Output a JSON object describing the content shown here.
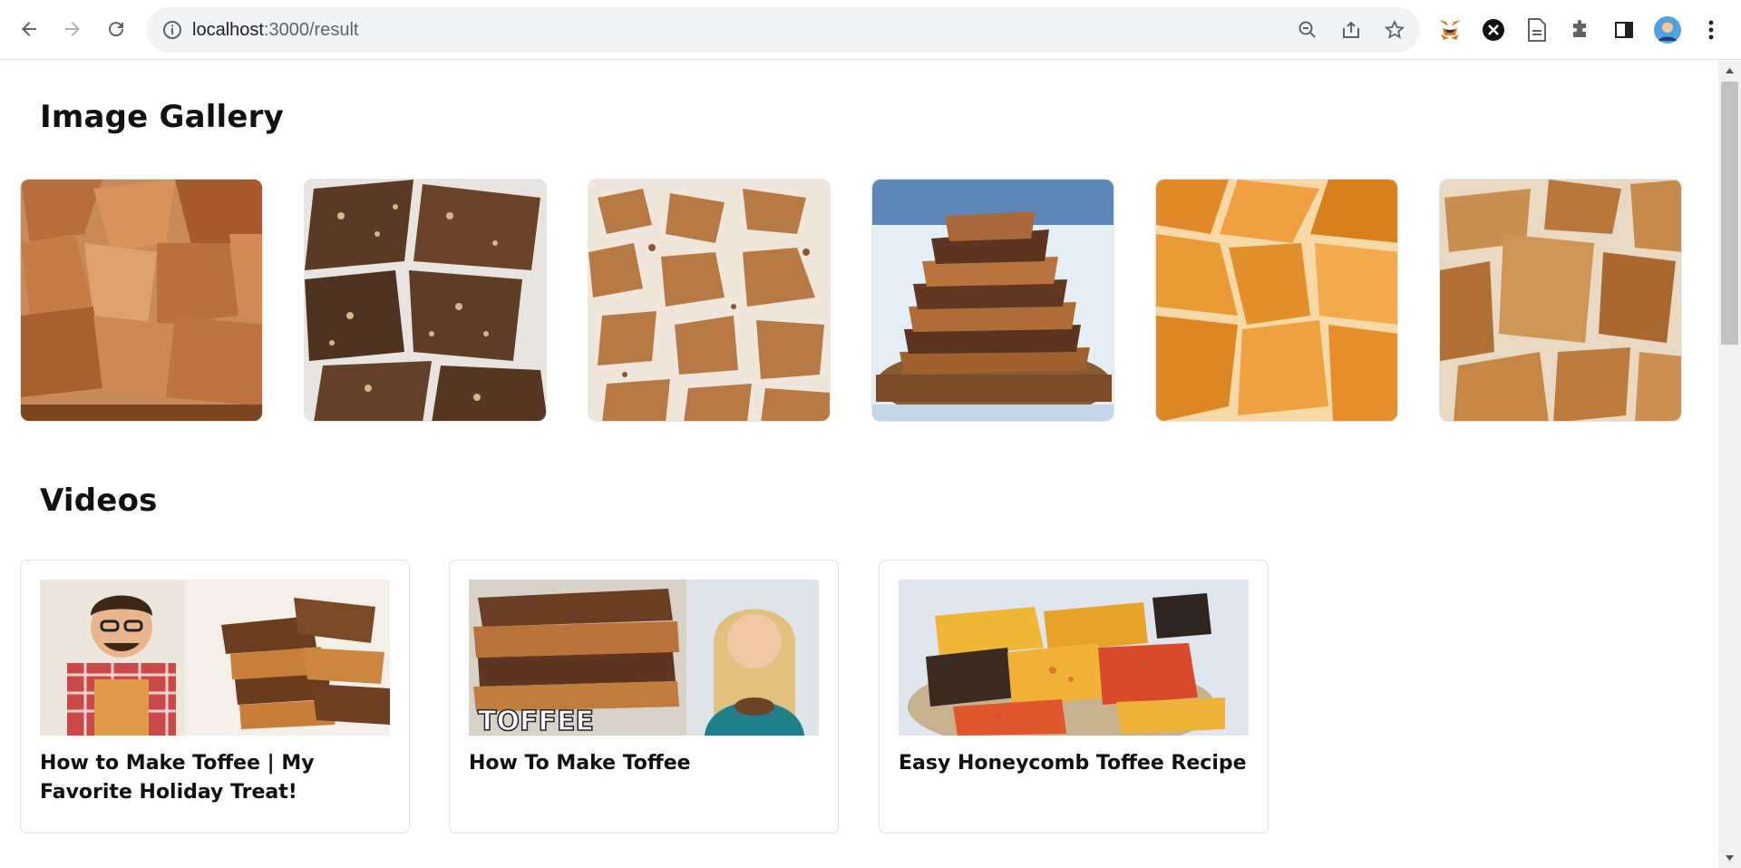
{
  "browser": {
    "url_host": "localhost",
    "url_path": ":3000/result"
  },
  "gallery": {
    "heading": "Image Gallery",
    "images": [
      {
        "icon": "toffee-chunks-photo"
      },
      {
        "icon": "nut-toffee-bark-photo"
      },
      {
        "icon": "crushed-toffee-photo"
      },
      {
        "icon": "stacked-toffee-photo"
      },
      {
        "icon": "amber-toffee-shards-photo"
      },
      {
        "icon": "toffee-pieces-photo"
      }
    ]
  },
  "videos": {
    "heading": "Videos",
    "items": [
      {
        "title": "How to Make Toffee | My Favorite Holiday Treat!"
      },
      {
        "title": "How To Make Toffee",
        "thumb_text": "TOFFEE"
      },
      {
        "title": "Easy Honeycomb Toffee Recipe"
      }
    ]
  }
}
